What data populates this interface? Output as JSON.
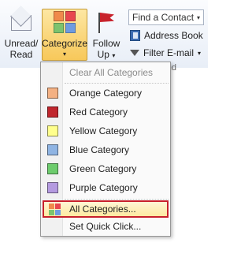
{
  "ribbon": {
    "unread_read": {
      "line1": "Unread/",
      "line2": "Read"
    },
    "categorize": {
      "label": "Categorize",
      "arrow": "▾"
    },
    "follow_up": {
      "line1": "Follow",
      "line2": "Up",
      "arrow": "▾"
    },
    "find_contact": {
      "placeholder": "Find a Contact",
      "arrow": "▾"
    },
    "address_book": {
      "label": "Address Book"
    },
    "filter_email": {
      "label": "Filter E-mail",
      "arrow": "▾"
    },
    "group_label_partial": "nd"
  },
  "colors": {
    "orange": "#f4b183",
    "red": "#c0262d",
    "yellow": "#ffff8c",
    "blue": "#8fb4e3",
    "green": "#6dcc6d",
    "purple": "#b49ae0",
    "highlight_border": "#c8202b"
  },
  "menu": {
    "clear_all": "Clear All Categories",
    "categories": [
      {
        "label": "Orange Category",
        "color": "#f4b183"
      },
      {
        "label": "Red Category",
        "color": "#c0262d"
      },
      {
        "label": "Yellow Category",
        "color": "#ffff8c"
      },
      {
        "label": "Blue Category",
        "color": "#8fb4e3"
      },
      {
        "label": "Green Category",
        "color": "#6dcc6d"
      },
      {
        "label": "Purple Category",
        "color": "#b49ae0"
      }
    ],
    "all_categories": "All Categories...",
    "set_quick_click": "Set Quick Click..."
  }
}
